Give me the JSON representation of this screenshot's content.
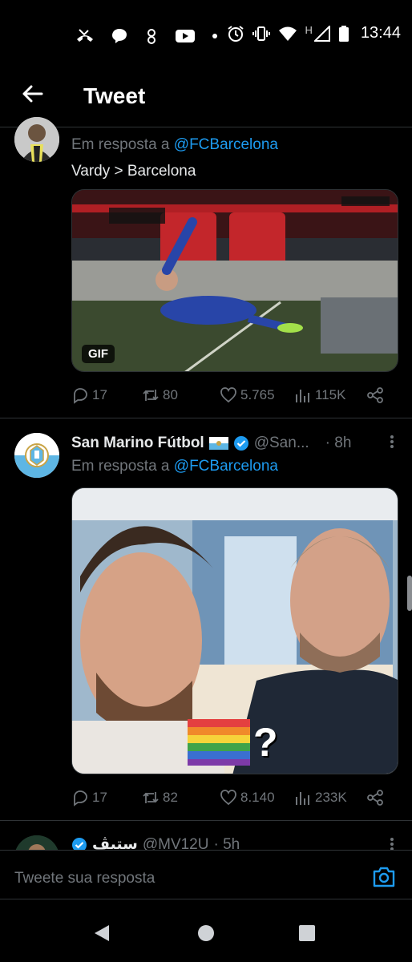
{
  "status_bar": {
    "time": "13:44",
    "network_label": "H",
    "left_icons": [
      "missed-call-icon",
      "chat-bubble-icon",
      "app-notification-icon",
      "youtube-icon",
      "dot-icon"
    ],
    "right_icons": [
      "alarm-icon",
      "vibrate-icon",
      "wifi-icon",
      "signal-icon",
      "battery-icon"
    ]
  },
  "header": {
    "title": "Tweet"
  },
  "tweets": [
    {
      "reply_prefix": "Em resposta a",
      "reply_handle": "@FCBarcelona",
      "text": "Vardy > Barcelona",
      "media_badge": "GIF",
      "stats": {
        "replies": "17",
        "retweets": "80",
        "likes": "5.765",
        "views": "115K"
      }
    },
    {
      "display_name": "San Marino Fútbol",
      "handle": "@San...",
      "time": "· 8h",
      "reply_prefix": "Em resposta a",
      "reply_handle": "@FCBarcelona",
      "media_caption": "?",
      "stats": {
        "replies": "17",
        "retweets": "82",
        "likes": "8.140",
        "views": "233K"
      }
    },
    {
      "display_name": "ستيڤ",
      "handle": "@MV12U",
      "time": "· 5h"
    }
  ],
  "reply_box": {
    "placeholder": "Tweete sua resposta"
  },
  "colors": {
    "background": "#000000",
    "accent": "#1d9bf0",
    "secondary_text": "#71767b",
    "divider": "#2f3336"
  }
}
